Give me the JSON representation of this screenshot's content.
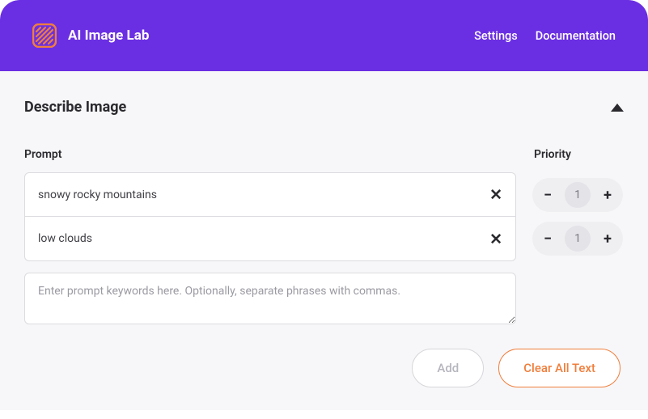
{
  "header": {
    "title": "AI Image Lab",
    "nav": {
      "settings": "Settings",
      "documentation": "Documentation"
    }
  },
  "section": {
    "title": "Describe Image",
    "labels": {
      "prompt": "Prompt",
      "priority": "Priority"
    },
    "prompts": [
      {
        "text": "snowy rocky mountains",
        "priority": "1"
      },
      {
        "text": "low clouds",
        "priority": "1"
      }
    ],
    "textarea_placeholder": "Enter prompt keywords here. Optionally, separate phrases with commas.",
    "buttons": {
      "add": "Add",
      "clear": "Clear All Text"
    }
  },
  "colors": {
    "accent": "#6b2fe3",
    "orange": "#f07e3c"
  }
}
